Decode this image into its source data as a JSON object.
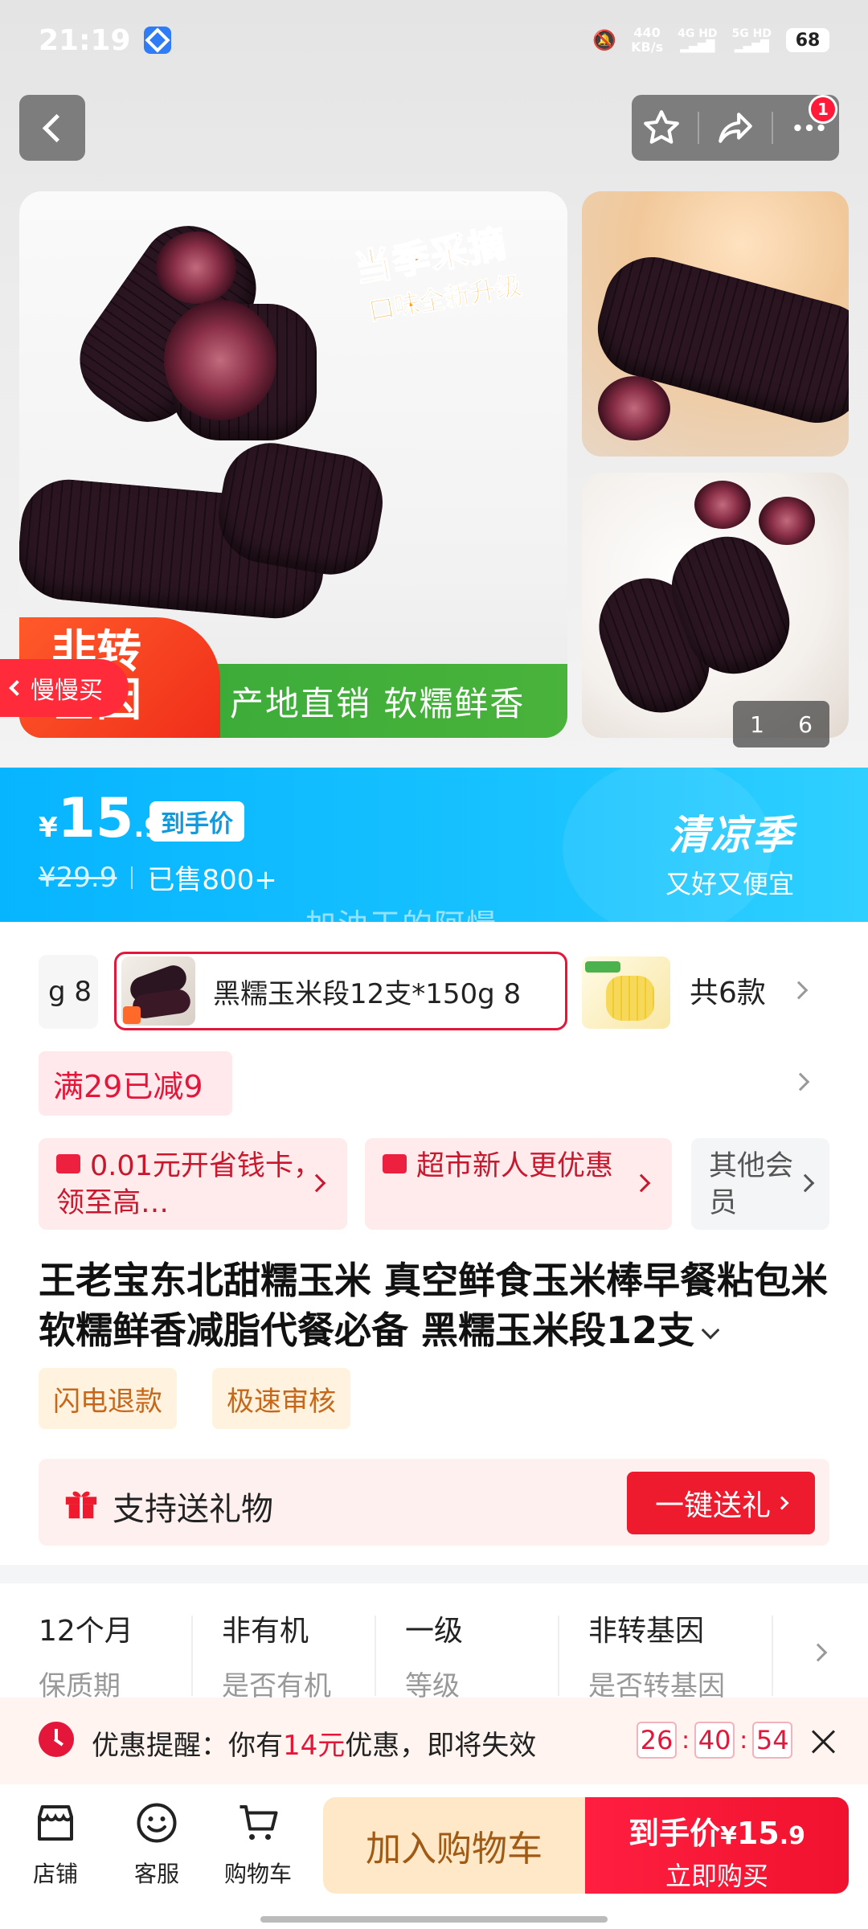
{
  "status_bar": {
    "time": "21:19",
    "net_speed": "440",
    "net_unit": "KB/s",
    "signal1": "4G HD",
    "signal2": "5G HD",
    "battery": "68"
  },
  "nav": {
    "notification_badge": "1"
  },
  "gallery": {
    "promo_line1": "当季采摘",
    "promo_line2": "口味全新升级",
    "green_banner": "产地直销 软糯鲜香",
    "red_tag": "非转\n基因",
    "slow_buy": "慢慢买",
    "pager_current": "1",
    "pager_total": "6"
  },
  "price": {
    "currency": "¥",
    "integer": "15",
    "decimal": ".9",
    "badge": "到手价",
    "original": "¥29.9",
    "sold": "已售800+",
    "season_title": "清凉季",
    "season_sub": "又好又便宜"
  },
  "watermark": "加油干的阿慢",
  "sku": {
    "partial_label": "g 8",
    "selected_label": "黑糯玉米段12支*150g 8",
    "count": "共6款"
  },
  "coupon": "满29已减9",
  "benefits": [
    {
      "text": "0.01元开省钱卡，领至高…"
    },
    {
      "text": "超市新人更优惠"
    },
    {
      "text": "其他会员"
    }
  ],
  "title": "王老宝东北甜糯玉米 真空鲜食玉米棒早餐粘包米软糯鲜香减脂代餐必备 黑糯玉米段12支",
  "tags": [
    "闪电退款",
    "极速审核"
  ],
  "gift": {
    "label": "支持送礼物",
    "button": "一键送礼"
  },
  "attributes": [
    {
      "value": "12个月",
      "key": "保质期"
    },
    {
      "value": "非有机",
      "key": "是否有机"
    },
    {
      "value": "一级",
      "key": "等级"
    },
    {
      "value": "非转基因",
      "key": "是否转基因"
    }
  ],
  "reminder": {
    "prefix": "优惠提醒：你有",
    "amount": "14元",
    "suffix": "优惠，即将失效",
    "hh": "26",
    "mm": "40",
    "ss": "54"
  },
  "bottom": {
    "shop": "店铺",
    "service": "客服",
    "cart": "购物车",
    "add_cart": "加入购物车",
    "buy_price_label": "到手价",
    "buy_price_currency": "¥",
    "buy_price_int": "15",
    "buy_price_dec": ".9",
    "buy_now": "立即购买"
  },
  "colors": {
    "accent_red": "#e4163a",
    "price_band": "#07b5ff",
    "cart_bg": "#ffe8c8"
  }
}
